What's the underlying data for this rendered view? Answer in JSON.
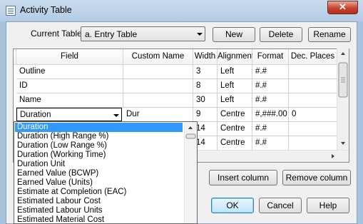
{
  "window": {
    "title": "Activity Table",
    "close_glyph": "✕"
  },
  "toolbar": {
    "current_table_label": "Current Table",
    "current_table_value": "a. Entry Table",
    "new_label": "New",
    "delete_label": "Delete",
    "rename_label": "Rename"
  },
  "grid": {
    "columns": [
      "Field",
      "Custom Name",
      "Width",
      "Alignment",
      "Format",
      "Dec. Places"
    ],
    "rows": [
      {
        "field": "Outline",
        "custom": "",
        "width": "3",
        "align": "Left",
        "format": "#.#",
        "dec": ""
      },
      {
        "field": "ID",
        "custom": "",
        "width": "8",
        "align": "Left",
        "format": "#.#",
        "dec": ""
      },
      {
        "field": "Name",
        "custom": "",
        "width": "30",
        "align": "Left",
        "format": "#.#",
        "dec": ""
      },
      {
        "field": "Duration",
        "custom": "Dur",
        "width": "9",
        "align": "Centre",
        "format": "#,###.00",
        "dec": "0"
      },
      {
        "field": "",
        "custom": "",
        "width": "14",
        "align": "Centre",
        "format": "#.#",
        "dec": ""
      },
      {
        "field": "",
        "custom": "",
        "width": "14",
        "align": "Centre",
        "format": "#.#",
        "dec": ""
      }
    ]
  },
  "field_dropdown": {
    "selected": "Duration",
    "options": [
      "Duration",
      "Duration (High Range %)",
      "Duration (Low Range %)",
      "Duration (Working Time)",
      "Duration Unit",
      "Earned Value (BCWP)",
      "Earned Value (Units)",
      "Estimate at Completion (EAC)",
      "Estimated Labour Cost",
      "Estimated Labour Units",
      "Estimated Material Cost"
    ]
  },
  "actions": {
    "insert_column": "Insert column",
    "remove_column": "Remove column",
    "ok": "OK",
    "cancel": "Cancel",
    "help": "Help"
  },
  "colors": {
    "selection": "#3399ff",
    "title_bar": "#b9d1ea",
    "close_button": "#c9432d"
  }
}
